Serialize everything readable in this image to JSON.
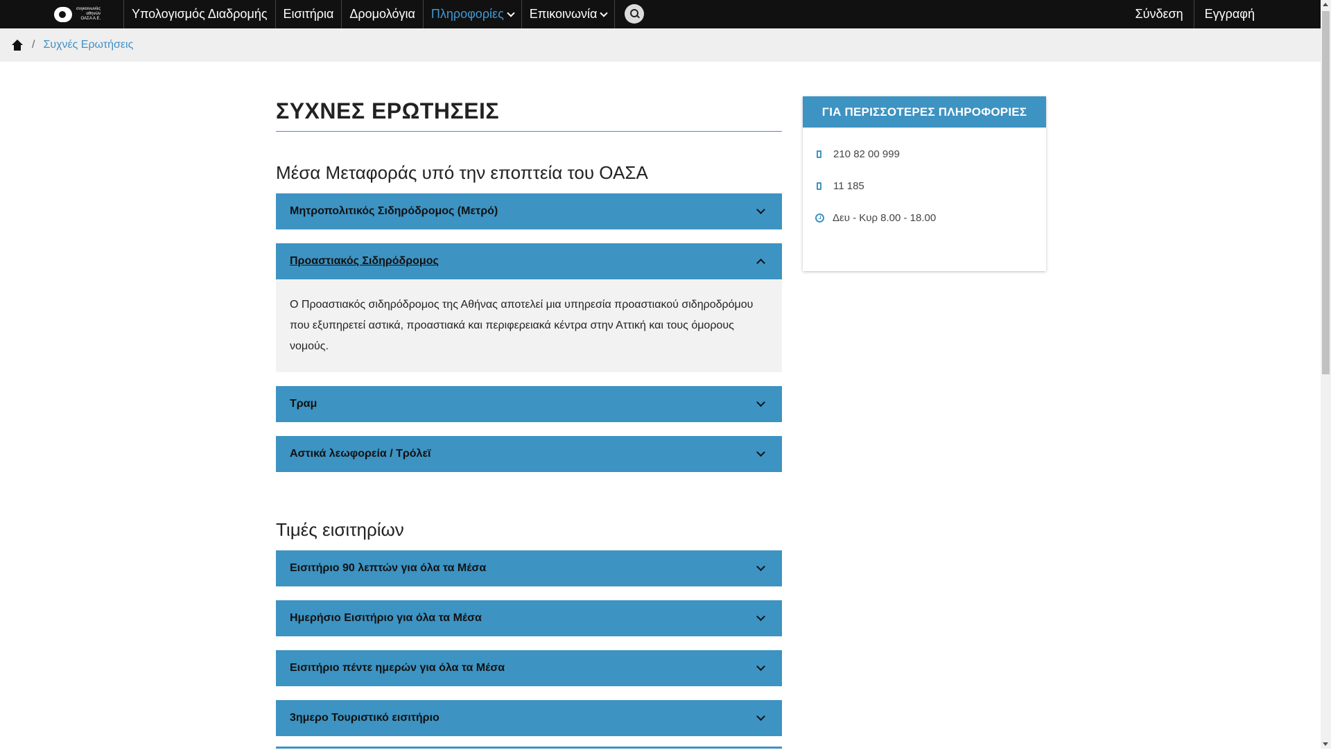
{
  "nav": {
    "logo_text": [
      "συγκοινωνίες",
      "αθηνών",
      "ΟΑΣΑ Α.Ε."
    ],
    "items": [
      {
        "label": "Υπολογισμός Διαδρομής",
        "dropdown": false,
        "active": false
      },
      {
        "label": "Εισιτήρια",
        "dropdown": false,
        "active": false
      },
      {
        "label": "Δρομολόγια",
        "dropdown": false,
        "active": false
      },
      {
        "label": "Πληροφορίες",
        "dropdown": true,
        "active": true
      },
      {
        "label": "Επικοινωνία",
        "dropdown": true,
        "active": false
      }
    ],
    "search_icon": "search-icon",
    "right_items": [
      {
        "label": "Σύνδεση"
      },
      {
        "label": "Εγγραφή"
      }
    ]
  },
  "breadcrumb": {
    "home_icon": "home-icon",
    "current": "Συχνές Ερωτήσεις"
  },
  "main": {
    "title": "ΣΥΧΝΕΣ ΕΡΩΤΗΣΕΙΣ",
    "sections": [
      {
        "title": "Μέσα Μεταφοράς υπό την εποπτεία του ΟΑΣΑ",
        "items": [
          {
            "label": "Μητροπολιτικός Σιδηρόδρομος (Μετρό)",
            "open": false
          },
          {
            "label": "Προαστιακός Σιδηρόδρομος",
            "open": true,
            "body": "Ο Προαστιακός σιδηρόδρομος της Αθήνας αποτελεί μια υπηρεσία προαστιακού σιδηροδρόμου που εξυπηρετεί αστικά, προαστιακά και περιφερειακά κέντρα στην Αττική και τους όμορους νομούς."
          },
          {
            "label": "Τραμ",
            "open": false
          },
          {
            "label": "Αστικά λεωφορεία / Τρόλεϊ",
            "open": false
          }
        ]
      },
      {
        "title": "Τιμές εισιτηρίων",
        "items": [
          {
            "label": "Εισιτήριο 90 λεπτών για όλα τα Μέσα",
            "open": false
          },
          {
            "label": "Ημερήσιο Εισιτήριο για όλα τα Μέσα",
            "open": false
          },
          {
            "label": "Εισιτήριο πέντε ημερών για όλα τα Μέσα",
            "open": false
          },
          {
            "label": "3ημερο Τουριστικό εισιτήριο",
            "open": false
          }
        ]
      }
    ]
  },
  "sidebar": {
    "title": "ΓΙΑ ΠΕΡΙΣΣΟΤΕΡΕΣ ΠΛΗΡΟΦΟΡΙΕΣ",
    "rows": [
      {
        "icon": "phone-icon",
        "text": "210 82 00 999"
      },
      {
        "icon": "phone-icon",
        "text": "11 185"
      },
      {
        "icon": "clock-icon",
        "text": "Δευ - Κυρ 8.00 - 18.00"
      }
    ]
  },
  "colors": {
    "nav_bg": "#111111",
    "accent": "#3d93c2",
    "link": "#3f8fc5",
    "breadcrumb_bg": "#efefef"
  }
}
